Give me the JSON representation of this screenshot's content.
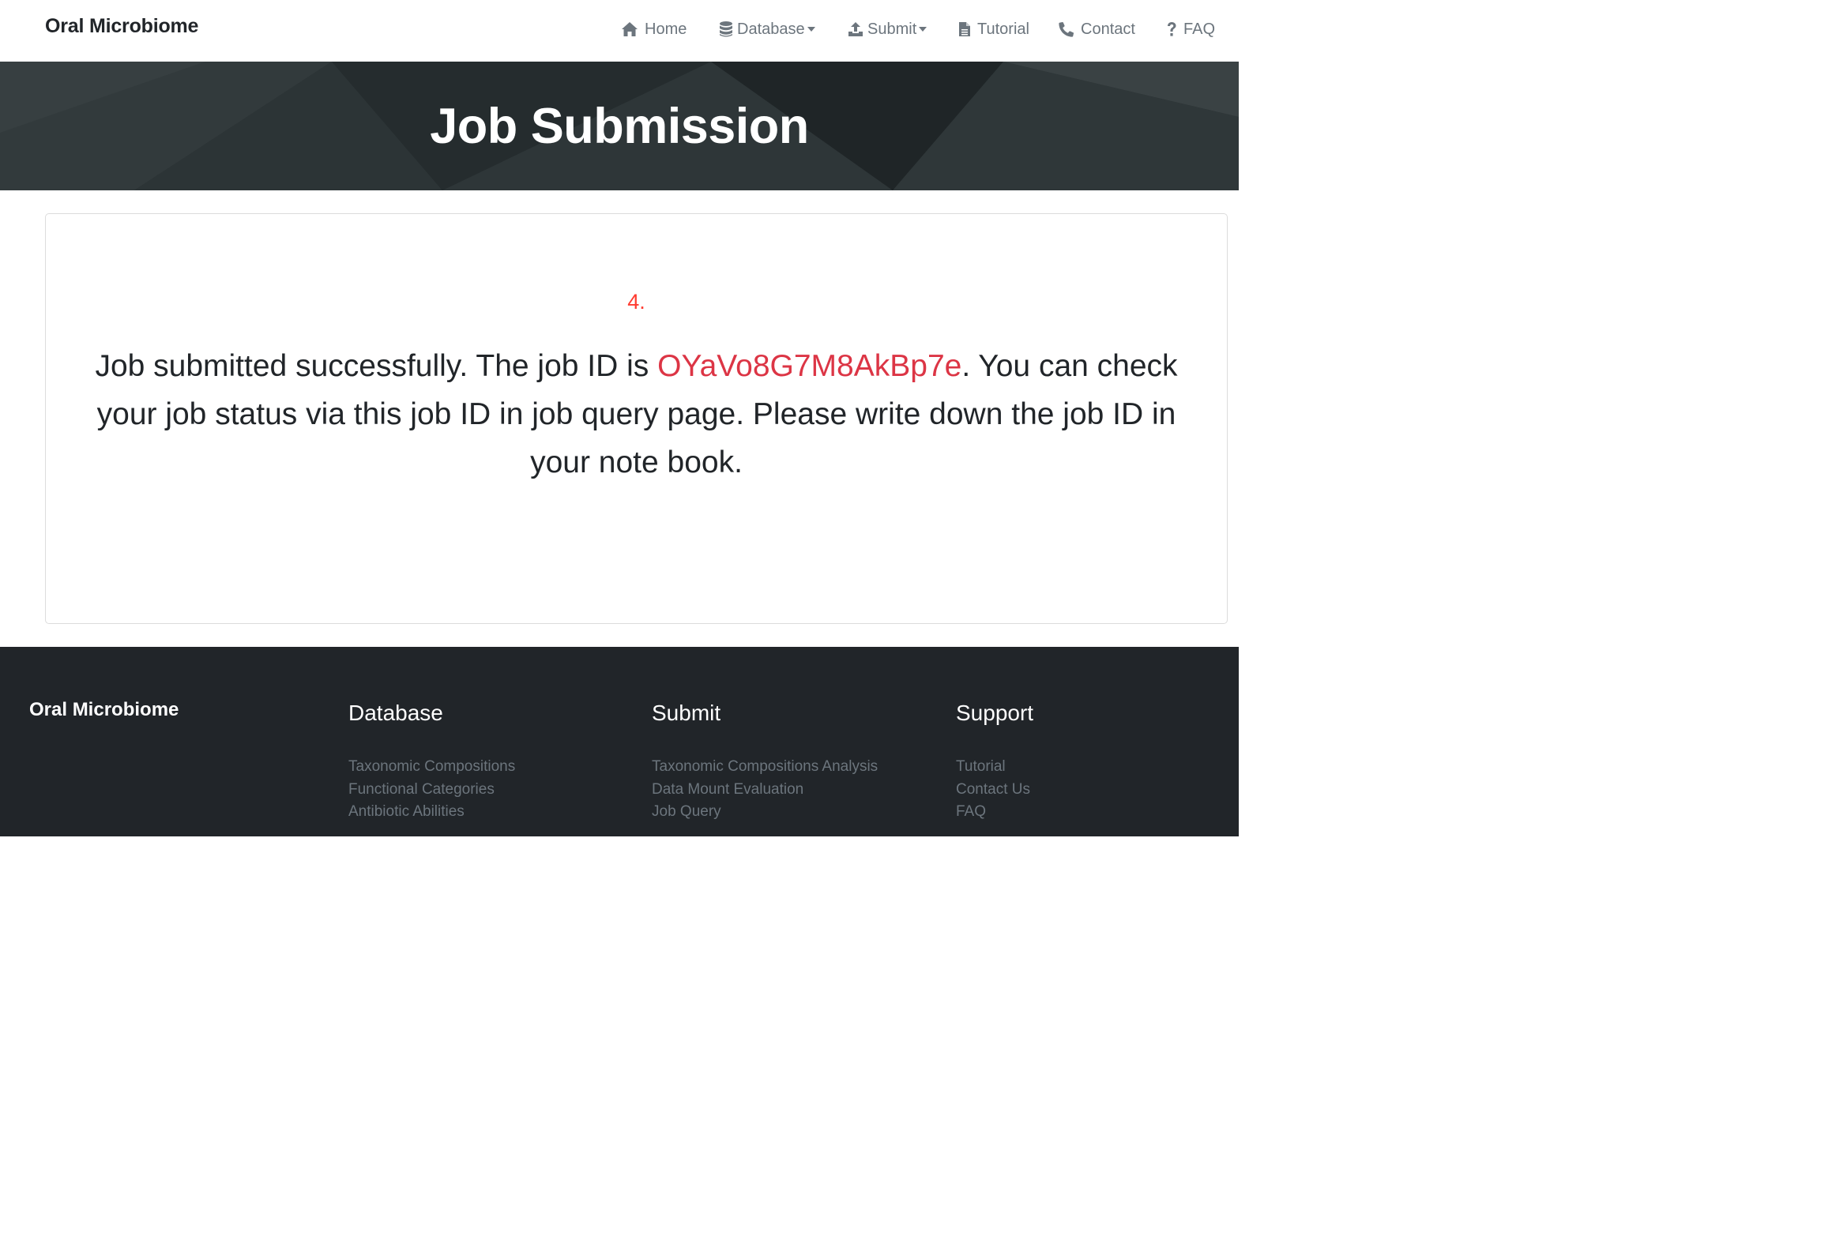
{
  "navbar": {
    "brand": "Oral Microbiome",
    "items": [
      {
        "label": "Home",
        "icon": "home-icon"
      },
      {
        "label": "Database",
        "icon": "database-icon",
        "dropdown": true
      },
      {
        "label": "Submit",
        "icon": "upload-icon",
        "dropdown": true
      },
      {
        "label": "Tutorial",
        "icon": "file-icon"
      },
      {
        "label": "Contact",
        "icon": "phone-icon"
      },
      {
        "label": "FAQ",
        "icon": "question-icon"
      }
    ]
  },
  "hero": {
    "title": "Job Submission"
  },
  "card": {
    "step": "4.",
    "message_before": "Job submitted successfully. The job ID is ",
    "job_id": "OYaVo8G7M8AkBp7e",
    "message_after": ". You can check your job status via this job ID in job query page. Please write down the job ID in your note book."
  },
  "footer": {
    "brand": "Oral Microbiome",
    "columns": [
      {
        "title": "Database",
        "links": [
          "Taxonomic Compositions",
          "Functional Categories",
          "Antibiotic Abilities"
        ]
      },
      {
        "title": "Submit",
        "links": [
          "Taxonomic Compositions Analysis",
          "Data Mount Evaluation",
          "Job Query"
        ]
      },
      {
        "title": "Support",
        "links": [
          "Tutorial",
          "Contact Us",
          "FAQ"
        ]
      }
    ]
  },
  "colors": {
    "job_id": "#dc3545",
    "step_number": "#ff3b30",
    "footer_bg": "#212529",
    "hero_bg": "#2a3133",
    "nav_text": "#6c757d"
  }
}
